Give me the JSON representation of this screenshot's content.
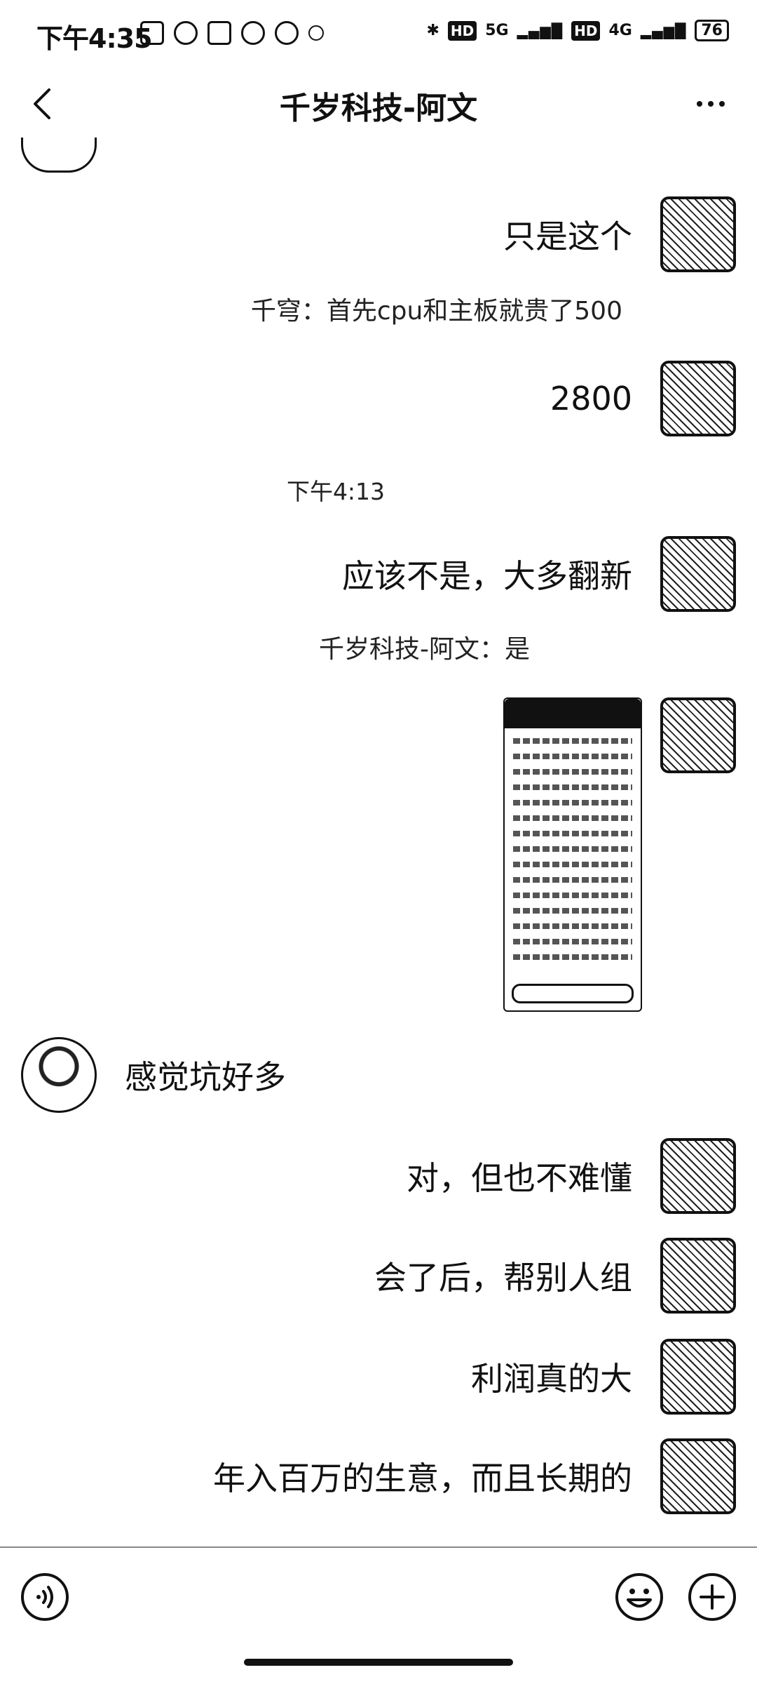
{
  "status_bar": {
    "time": "下午4:35",
    "network_5g": "5G",
    "network_4g": "4G",
    "hd": "HD",
    "battery": "76"
  },
  "nav": {
    "title": "千岁科技-阿文"
  },
  "messages": [
    {
      "side": "right",
      "type": "text",
      "text": "只是这个"
    },
    {
      "type": "quote",
      "text": "千穹：首先cpu和主板就贵了500"
    },
    {
      "side": "right",
      "type": "text",
      "text": "2800"
    },
    {
      "type": "time",
      "text": "下午4:13"
    },
    {
      "side": "right",
      "type": "text",
      "text": "应该不是，大多翻新"
    },
    {
      "type": "quote",
      "text": "千岁科技-阿文：是"
    },
    {
      "side": "right",
      "type": "image",
      "text": ""
    },
    {
      "side": "left",
      "type": "text",
      "text": "感觉坑好多"
    },
    {
      "side": "right",
      "type": "text",
      "text": "对，但也不难懂"
    },
    {
      "side": "right",
      "type": "text",
      "text": "会了后，帮别人组"
    },
    {
      "side": "right",
      "type": "text",
      "text": "利润真的大"
    },
    {
      "side": "right",
      "type": "text",
      "text": "年入百万的生意，而且长期的"
    }
  ],
  "input": {
    "voice_icon": "voice-icon",
    "emoji_icon": "emoji-icon",
    "plus_icon": "plus-icon"
  }
}
